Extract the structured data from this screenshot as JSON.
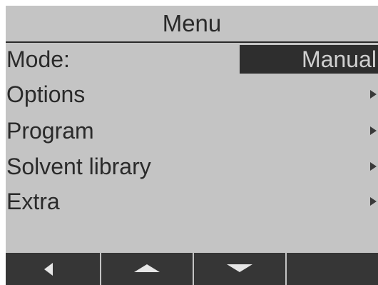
{
  "header": {
    "title": "Menu"
  },
  "menu": {
    "mode": {
      "label": "Mode:",
      "value": "Manual"
    },
    "items": [
      {
        "label": "Options",
        "icon": "chevron-right-icon"
      },
      {
        "label": "Program",
        "icon": "chevron-right-icon"
      },
      {
        "label": "Solvent library",
        "icon": "chevron-right-icon"
      },
      {
        "label": "Extra",
        "icon": "chevron-right-icon"
      }
    ]
  },
  "softkeys": [
    {
      "icon": "arrow-left-icon"
    },
    {
      "icon": "arrow-up-icon"
    },
    {
      "icon": "arrow-down-icon"
    },
    {
      "icon": ""
    }
  ],
  "colors": {
    "screen_background": "#c4c4c4",
    "text": "#2a2a2a",
    "highlight_background": "#2e2e2e",
    "softkey_background": "#363636",
    "softkey_icon": "#e6e6e6"
  }
}
